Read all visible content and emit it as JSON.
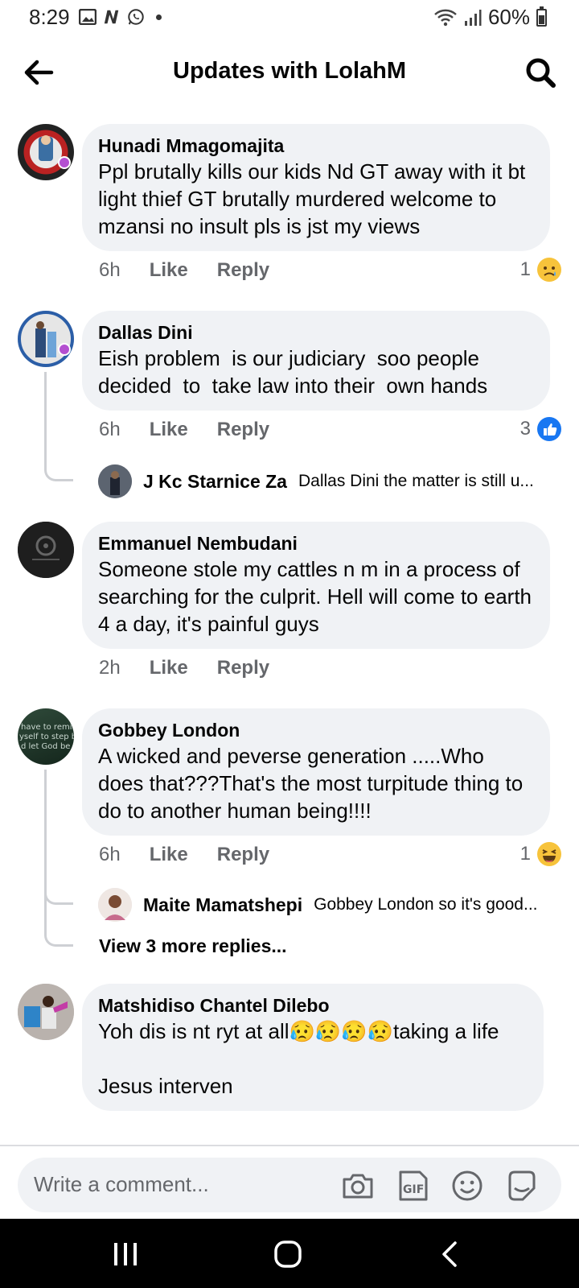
{
  "status": {
    "time": "8:29",
    "battery": "60%",
    "battery_level": 0.6
  },
  "header": {
    "title": "Updates with LolahM",
    "back_icon": "back-arrow-icon",
    "search_icon": "search-icon"
  },
  "comments": [
    {
      "name": "Hunadi Mmagomajita",
      "text": "Ppl brutally kills our kids Nd GT away with it bt light thief GT brutally murdered welcome to mzansi no insult pls is jst my views",
      "time": "6h",
      "like": "Like",
      "reply": "Reply",
      "reaction_count": "1",
      "reaction": "sad-icon"
    },
    {
      "name": "Dallas Dini",
      "text": "Eish problem  is our judiciary  soo people decided  to  take law into their  own hands",
      "time": "6h",
      "like": "Like",
      "reply": "Reply",
      "reaction_count": "3",
      "reaction": "like-icon",
      "reply_preview": {
        "name": "J Kc Starnice Za",
        "text": "Dallas Dini the matter is still u..."
      }
    },
    {
      "name": "Emmanuel Nembudani",
      "text": "Someone stole my cattles n m in a process of searching for the culprit. Hell will come to earth 4 a day, it's painful guys",
      "time": "2h",
      "like": "Like",
      "reply": "Reply"
    },
    {
      "name": "Gobbey London",
      "text": "A wicked and peverse generation .....Who does that???That's the most turpitude thing to do to another human being!!!!",
      "time": "6h",
      "like": "Like",
      "reply": "Reply",
      "reaction_count": "1",
      "reaction": "haha-icon",
      "reply_preview": {
        "name": "Maite Mamatshepi",
        "text": "Gobbey London so it's good..."
      },
      "more_replies": "View 3 more replies..."
    },
    {
      "name": "Matshidiso Chantel Dilebo",
      "text": "Yoh dis is nt ryt at all😥😥😥😥taking a life\n\nJesus interven"
    }
  ],
  "compose": {
    "placeholder": "Write a comment...",
    "icons": [
      "camera-icon",
      "gif-icon",
      "emoji-icon",
      "sticker-icon"
    ]
  },
  "navbar": {
    "icons": [
      "recent-apps-icon",
      "home-icon",
      "back-icon"
    ]
  }
}
